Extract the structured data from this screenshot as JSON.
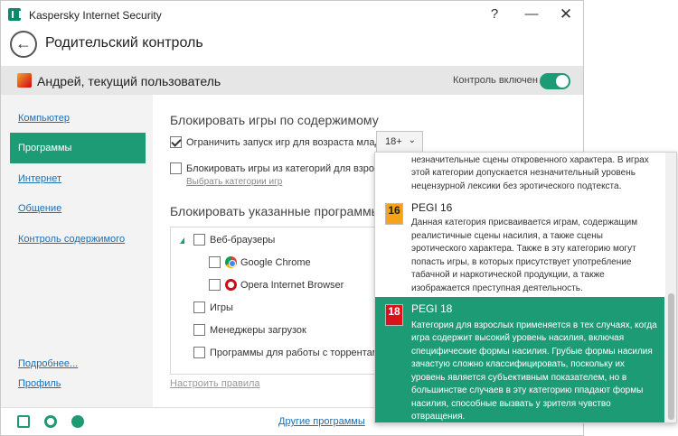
{
  "window": {
    "app_title": "Kaspersky Internet Security",
    "help_glyph": "?",
    "min_glyph": "—",
    "close_glyph": "✕"
  },
  "header": {
    "back_glyph": "←",
    "page_title": "Родительский контроль"
  },
  "userbar": {
    "user_name": "Андрей, текущий пользователь",
    "control_label": "Контроль включен",
    "control_enabled": true
  },
  "sidebar": {
    "items": [
      {
        "label": "Компьютер"
      },
      {
        "label": "Программы",
        "active": true
      },
      {
        "label": "Интернет"
      },
      {
        "label": "Общение"
      },
      {
        "label": "Контроль содержимого"
      }
    ],
    "more_link": "Подробнее...",
    "profile_link": "Профиль"
  },
  "main": {
    "block_by_content_title": "Блокировать игры по содержимому",
    "limit_age_label": "Ограничить запуск игр для возраста младше",
    "limit_age_checked": true,
    "age_value": "18+",
    "block_adult_categories_label": "Блокировать игры из категорий для взрослых",
    "block_adult_categories_checked": false,
    "choose_categories_link": "Выбрать категории игр",
    "block_programs_title": "Блокировать указанные программы:",
    "programs": [
      {
        "label": "Веб-браузеры",
        "level": 0,
        "expandable": true
      },
      {
        "label": "Google Chrome",
        "level": 1,
        "icon": "chrome-icon"
      },
      {
        "label": "Opera Internet Browser",
        "level": 1,
        "icon": "opera-icon"
      },
      {
        "label": "Игры",
        "level": 0
      },
      {
        "label": "Менеджеры загрузок",
        "level": 0
      },
      {
        "label": "Программы для работы с торрентами",
        "level": 0
      }
    ],
    "configure_rules_link": "Настроить правила"
  },
  "bottombar": {
    "icons": [
      "mail-icon",
      "gear-icon",
      "support-icon"
    ],
    "other_programs_link": "Другие программы"
  },
  "popup": {
    "prev_tail_lines": [
      "незначительные сцены откровенного характера. В играх",
      "этой категории допускается незначительный уровень",
      "нецензурной лексики без эротического подтекста."
    ],
    "pegi16": {
      "badge": "16",
      "title": "PEGI 16",
      "lines": [
        "Данная категория присваивается играм, содержащим",
        "реалистичные сцены насилия, а также сцены",
        "эротического характера. Также в эту категорию могут",
        "попасть игры, в которых присутствует употребление",
        "табачной и наркотической продукции, а также",
        "изображается преступная деятельность."
      ]
    },
    "pegi18": {
      "badge": "18",
      "title": "PEGI 18",
      "selected": true,
      "lines": [
        "Категория для взрослых применяется в тех случаях, когда",
        "игра содержит высокий уровень насилия, включая",
        "специфические формы насилия. Грубые формы насилия",
        "зачастую сложно классифицировать, поскольку их",
        "уровень является субъективным показателем, но в",
        "большинстве случаев в эту категорию ппадают формы",
        "насилия, способные вызвать у зрителя чувство",
        "отвращения."
      ]
    }
  },
  "colors": {
    "accent": "#1d9b75",
    "link": "#1a6fb5"
  }
}
